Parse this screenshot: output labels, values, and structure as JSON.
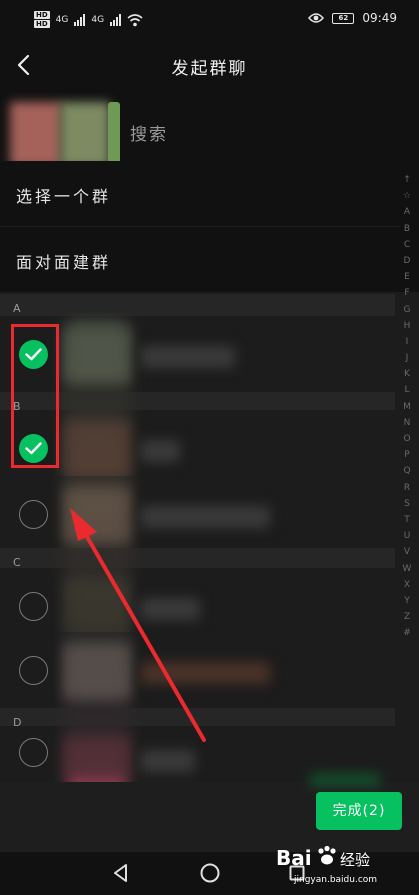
{
  "status_bar": {
    "network_hd_1": "HD",
    "network_hd_2": "HD",
    "network_4g_1": "4G",
    "network_4g_2": "4G",
    "battery": "62",
    "time": "09:49"
  },
  "header": {
    "title": "发起群聊"
  },
  "search": {
    "label": "搜索"
  },
  "menu": {
    "select_group": "选择一个群",
    "face_to_face": "面对面建群"
  },
  "sections": [
    {
      "letter": "A"
    },
    {
      "letter": "B"
    },
    {
      "letter": "C"
    },
    {
      "letter": "D"
    }
  ],
  "contacts": [
    {
      "checked": true
    },
    {
      "checked": true
    },
    {
      "checked": false
    },
    {
      "checked": false
    },
    {
      "checked": false
    },
    {
      "checked": false
    }
  ],
  "index_letters": [
    "↑",
    "☆",
    "A",
    "B",
    "C",
    "D",
    "E",
    "F",
    "G",
    "H",
    "I",
    "J",
    "K",
    "L",
    "M",
    "N",
    "O",
    "P",
    "Q",
    "R",
    "S",
    "T",
    "U",
    "V",
    "W",
    "X",
    "Y",
    "Z",
    "#"
  ],
  "footer": {
    "done_label": "完成(2)"
  },
  "watermark": {
    "brand": "Bai",
    "brand_suffix": "经验",
    "url": "jingyan.baidu.com"
  },
  "colors": {
    "accent": "#07c160",
    "annotation": "#ea2a2f",
    "background": "#111111",
    "list_background": "#1c1c1c"
  }
}
